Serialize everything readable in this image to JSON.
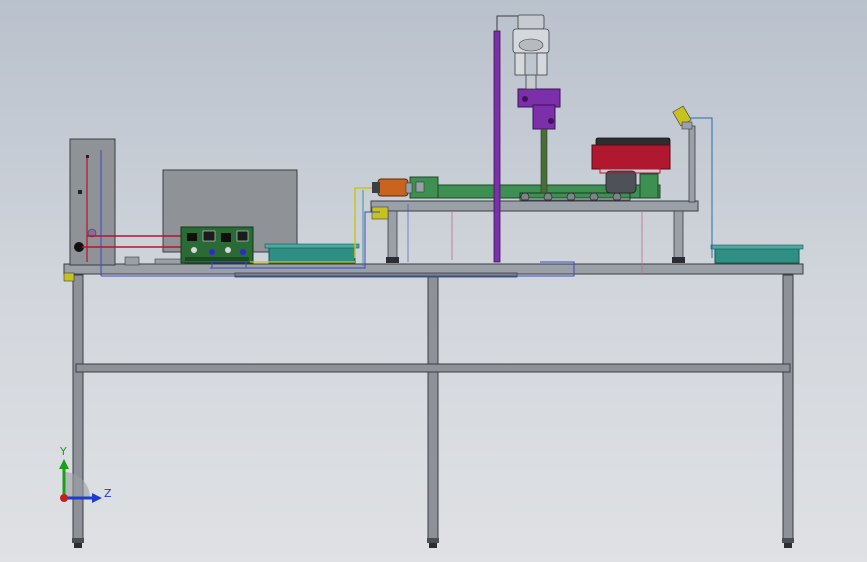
{
  "view": {
    "mode": "side",
    "background_top": "#b9c1cc",
    "background_bottom": "#dfe1e4"
  },
  "triad": {
    "y_label": "Y",
    "z_label": "Z",
    "y_color": "#19a019",
    "z_color": "#1e3cd2",
    "origin_color": "#c81e1e"
  },
  "colors": {
    "frame": "#8e9298",
    "frame_dark": "#3b3e43",
    "tabletop": "#9aa0a7",
    "bin": "#2f8f85",
    "rail": "#3e8f52",
    "robot_purple": "#7b2fa8",
    "tray_red": "#b01830",
    "motor_orange": "#c8641e",
    "bracket_yellow": "#c7c31e",
    "panel": "#8f9296",
    "pcb": "#2a6a34"
  }
}
